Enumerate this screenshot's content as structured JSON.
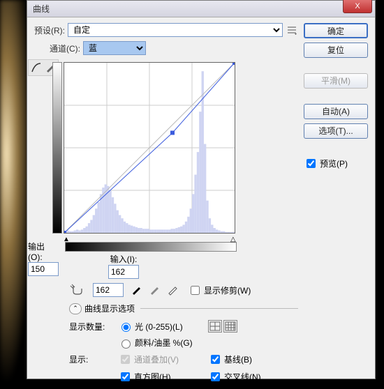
{
  "title": "曲线",
  "preset": {
    "label": "预设(R):",
    "value": "自定"
  },
  "channel": {
    "label": "通道(C):",
    "value": "蓝"
  },
  "output": {
    "label": "输出(O):",
    "value": "150"
  },
  "input": {
    "label": "输入(I):",
    "value": "162"
  },
  "show_clip": "显示修剪(W)",
  "disclosure_label": "曲线显示选项",
  "show_amount_label": "显示数量:",
  "amount_light": "光 (0-255)(L)",
  "amount_pigment": "颜料/油墨 %(G)",
  "show_label": "显示:",
  "show_overlay": "通道叠加(V)",
  "show_baseline": "基线(B)",
  "show_hist": "直方图(H)",
  "show_intersect": "交叉线(N)",
  "buttons": {
    "ok": "确定",
    "reset": "复位",
    "smooth": "平滑(M)",
    "auto": "自动(A)",
    "options": "选项(T)..."
  },
  "preview": "预览(P)",
  "chart_data": {
    "type": "line",
    "title": "",
    "xlabel": "输入",
    "ylabel": "输出",
    "xlim": [
      0,
      255
    ],
    "ylim": [
      0,
      255
    ],
    "series": [
      {
        "name": "curve",
        "points": [
          [
            0,
            0
          ],
          [
            162,
            150
          ],
          [
            255,
            255
          ]
        ]
      }
    ],
    "histogram_approx": [
      2,
      3,
      2,
      2,
      3,
      4,
      3,
      4,
      6,
      8,
      12,
      16,
      22,
      30,
      38,
      48,
      56,
      60,
      58,
      52,
      44,
      36,
      28,
      22,
      18,
      14,
      12,
      10,
      9,
      8,
      7,
      6,
      6,
      5,
      5,
      5,
      4,
      4,
      4,
      4,
      4,
      4,
      4,
      4,
      4,
      5,
      5,
      6,
      7,
      8,
      10,
      14,
      20,
      30,
      48,
      72,
      100,
      150,
      200,
      110,
      40,
      18,
      10,
      6,
      4,
      3,
      2,
      2,
      1,
      1,
      1,
      1
    ]
  }
}
